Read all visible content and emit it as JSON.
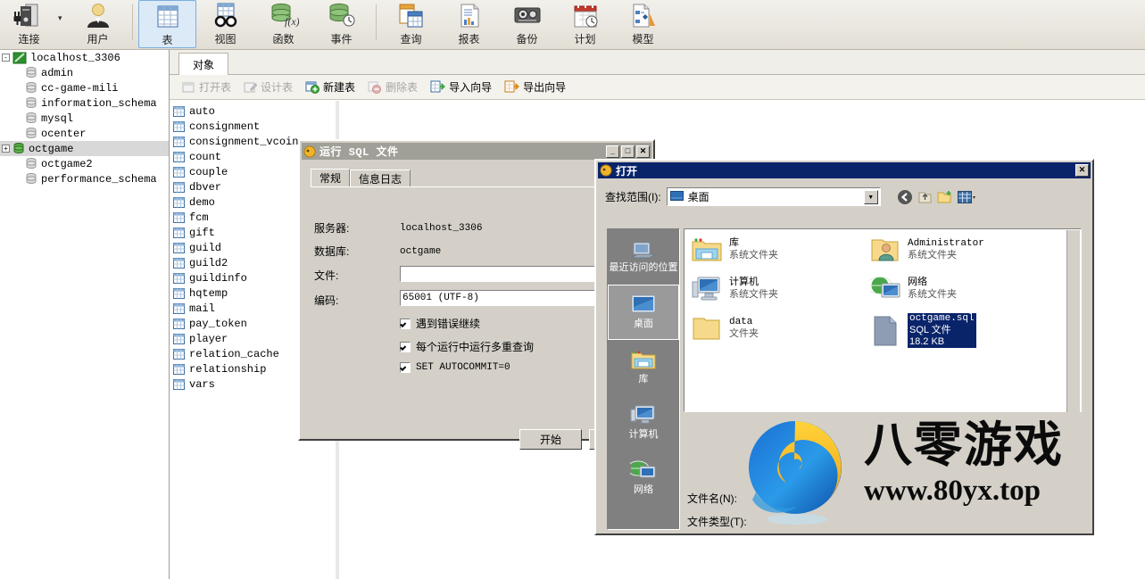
{
  "toolbar": {
    "items": [
      {
        "label": "连接",
        "icon": "connection-icon"
      },
      {
        "label": "用户",
        "icon": "user-icon"
      },
      {
        "label": "表",
        "icon": "table-icon"
      },
      {
        "label": "视图",
        "icon": "view-icon"
      },
      {
        "label": "函数",
        "icon": "function-icon"
      },
      {
        "label": "事件",
        "icon": "event-icon"
      },
      {
        "label": "查询",
        "icon": "query-icon"
      },
      {
        "label": "报表",
        "icon": "report-icon"
      },
      {
        "label": "备份",
        "icon": "backup-icon"
      },
      {
        "label": "计划",
        "icon": "schedule-icon"
      },
      {
        "label": "模型",
        "icon": "model-icon"
      }
    ],
    "selected": "表"
  },
  "tree": {
    "root": "localhost_3306",
    "items": [
      {
        "label": "admin",
        "selected": false,
        "expandable": false
      },
      {
        "label": "cc-game-mili",
        "selected": false,
        "expandable": false
      },
      {
        "label": "information_schema",
        "selected": false,
        "expandable": false
      },
      {
        "label": "mysql",
        "selected": false,
        "expandable": false
      },
      {
        "label": "ocenter",
        "selected": false,
        "expandable": false
      },
      {
        "label": "octgame",
        "selected": true,
        "expandable": true
      },
      {
        "label": "octgame2",
        "selected": false,
        "expandable": false
      },
      {
        "label": "performance_schema",
        "selected": false,
        "expandable": false
      }
    ]
  },
  "object_panel": {
    "tab": "对象",
    "buttons": [
      {
        "label": "打开表",
        "enabled": false,
        "icon": "open-table-icon"
      },
      {
        "label": "设计表",
        "enabled": false,
        "icon": "design-table-icon"
      },
      {
        "label": "新建表",
        "enabled": true,
        "icon": "new-table-icon"
      },
      {
        "label": "删除表",
        "enabled": false,
        "icon": "delete-table-icon"
      },
      {
        "label": "导入向导",
        "enabled": true,
        "icon": "import-wizard-icon"
      },
      {
        "label": "导出向导",
        "enabled": true,
        "icon": "export-wizard-icon"
      }
    ],
    "tables": [
      "auto",
      "consignment",
      "consignment_vcoin",
      "count",
      "couple",
      "dbver",
      "demo",
      "fcm",
      "gift",
      "guild",
      "guild2",
      "guildinfo",
      "hqtemp",
      "mail",
      "pay_token",
      "player",
      "relation_cache",
      "relationship",
      "vars"
    ]
  },
  "sql_dialog": {
    "title": "运行 SQL 文件",
    "window_buttons": {
      "minimize": "_",
      "maximize": "□",
      "close": "✕"
    },
    "tabs": [
      {
        "label": "常规",
        "active": true
      },
      {
        "label": "信息日志",
        "active": false
      }
    ],
    "fields": [
      {
        "label": "服务器:",
        "value": "localhost_3306"
      },
      {
        "label": "数据库:",
        "value": "octgame"
      }
    ],
    "file_label": "文件:",
    "file_value": "",
    "encoding_label": "编码:",
    "encoding_value": "65001 (UTF-8)",
    "checkboxes": [
      {
        "label": "遇到错误继续",
        "checked": true
      },
      {
        "label": "每个运行中运行多重查询",
        "checked": true
      },
      {
        "label": "SET AUTOCOMMIT=0",
        "checked": true
      }
    ],
    "start_button": "开始"
  },
  "open_dialog": {
    "title": "打开",
    "close_button": "✕",
    "look_in_label": "查找范围(I):",
    "look_in_value": "桌面",
    "nav_icons": [
      "back-icon",
      "up-folder-icon",
      "new-folder-icon",
      "views-icon"
    ],
    "places": [
      {
        "label": "最近访问的位置",
        "icon": "recent-places-icon",
        "selected": false
      },
      {
        "label": "桌面",
        "icon": "desktop-icon",
        "selected": true
      },
      {
        "label": "库",
        "icon": "library-icon",
        "selected": false
      },
      {
        "label": "计算机",
        "icon": "computer-icon",
        "selected": false
      },
      {
        "label": "网络",
        "icon": "network-icon",
        "selected": false
      }
    ],
    "files": [
      {
        "name": "库",
        "sub": "系统文件夹",
        "icon": "library-folder-icon",
        "selected": false,
        "col": 0,
        "row": 0
      },
      {
        "name": "Administrator",
        "sub": "系统文件夹",
        "icon": "user-folder-icon",
        "selected": false,
        "col": 1,
        "row": 0
      },
      {
        "name": "计算机",
        "sub": "系统文件夹",
        "icon": "computer-icon",
        "selected": false,
        "col": 0,
        "row": 1
      },
      {
        "name": "网络",
        "sub": "系统文件夹",
        "icon": "network-icon",
        "selected": false,
        "col": 1,
        "row": 1
      },
      {
        "name": "data",
        "sub": "文件夹",
        "icon": "folder-icon",
        "selected": false,
        "col": 0,
        "row": 2
      },
      {
        "name": "octgame.sql",
        "sub": "SQL 文件",
        "size": "18.2 KB",
        "icon": "sql-file-icon",
        "selected": true,
        "col": 1,
        "row": 2
      }
    ],
    "filename_label": "文件名(N):",
    "filename_value": "",
    "filetype_label": "文件类型(T):",
    "filetype_value": ""
  },
  "watermark": {
    "cn": "八零游戏",
    "url": "www.80yx.top"
  }
}
